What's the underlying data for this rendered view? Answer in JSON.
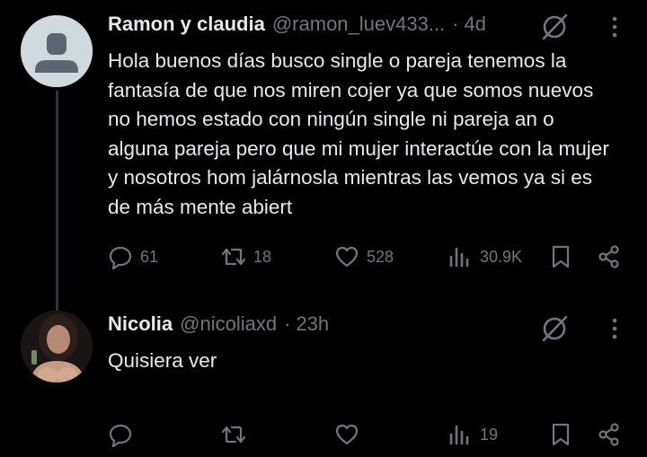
{
  "tweets": [
    {
      "name": "Ramon y claudia",
      "handle": "@ramon_luev433...",
      "dot": "·",
      "time": "4d",
      "text": "Hola buenos días busco single o pareja tenemos la fantasía de que nos miren cojer ya que somos nuevos no hemos estado con ningún single ni pareja an o alguna pareja pero que mi mujer interactúe con la mujer y nosotros hom jalárnosla mientras las vemos ya si es de más mente abiert",
      "replies": "61",
      "retweets": "18",
      "likes": "528",
      "views": "30.9K",
      "avatar": "default-avatar"
    },
    {
      "name": "Nicolia",
      "handle": "@nicoliaxd",
      "dot": "·",
      "time": "23h",
      "text": "Quisiera ver",
      "replies": "",
      "retweets": "",
      "likes": "",
      "views": "19",
      "avatar": "photo-avatar"
    }
  ],
  "icons": {
    "grok": "grok-icon",
    "more": "more-icon",
    "reply": "reply-icon",
    "retweet": "retweet-icon",
    "like": "heart-icon",
    "views": "views-icon",
    "bookmark": "bookmark-icon",
    "share": "share-icon"
  },
  "colors": {
    "background": "#000000",
    "text": "#e7e9ea",
    "secondary": "#71767b",
    "thread_line": "#333639"
  }
}
